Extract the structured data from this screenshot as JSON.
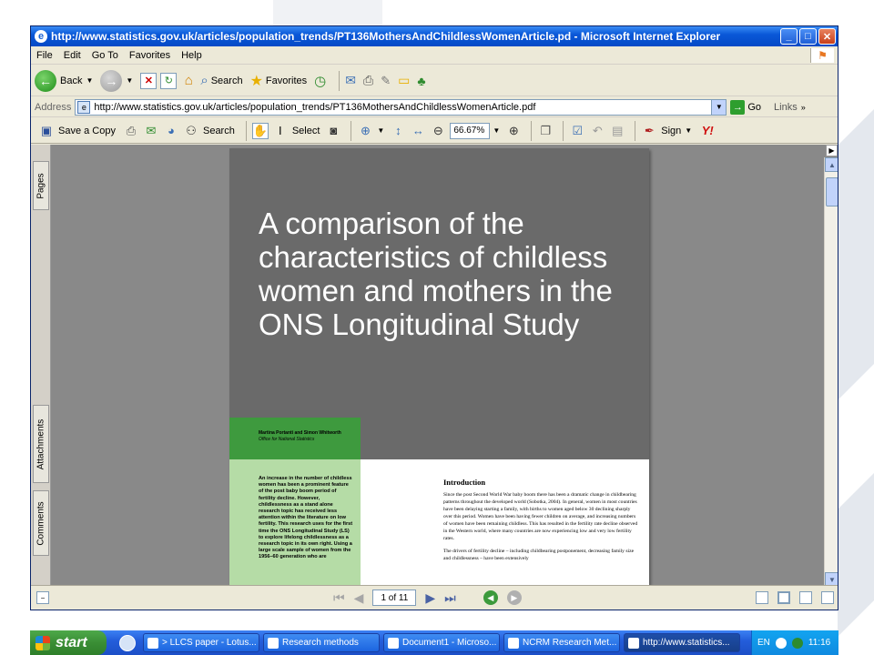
{
  "window": {
    "title": "http://www.statistics.gov.uk/articles/population_trends/PT136MothersAndChildlessWomenArticle.pd - Microsoft Internet Explorer",
    "controls": {
      "minimize": "_",
      "maximize": "□",
      "close": "✕"
    }
  },
  "menu": [
    "File",
    "Edit",
    "Go To",
    "Favorites",
    "Help"
  ],
  "toolbar": {
    "back": "Back",
    "search": "Search",
    "favorites": "Favorites"
  },
  "address": {
    "label": "Address",
    "url": "http://www.statistics.gov.uk/articles/population_trends/PT136MothersAndChildlessWomenArticle.pdf",
    "go": "Go",
    "links": "Links"
  },
  "pdf_toolbar": {
    "save_copy": "Save a Copy",
    "search": "Search",
    "select": "Select",
    "zoom": "66.67%",
    "sign": "Sign"
  },
  "side_tabs": [
    "Pages",
    "Attachments",
    "Comments"
  ],
  "document": {
    "title": "A comparison of the characteristics of childless women and mothers in the ONS Longitudinal Study",
    "authors": "Martina Portanti and Simon Whitworth",
    "affiliation": "Office for National Statistics",
    "abstract": "An increase in the number of childless women has been a prominent feature of the post baby boom period of fertility decline. However, childlessness as a stand alone research topic has received less attention within the literature on low fertility. This research uses for the first time the ONS Longitudinal Study (LS) to explore lifelong childlessness as a research topic in its own right. Using a large scale sample of women from the 1956–60 generation who are",
    "intro_heading": "Introduction",
    "intro_p1": "Since the post Second World War baby boom there has been a dramatic change in childbearing patterns throughout the developed world (Sobotka, 2004). In general, women in most countries have been delaying starting a family, with births to women aged below 30 declining sharply over this period. Women have been having fewer children on average, and increasing numbers of women have been remaining childless. This has resulted in the fertility rate decline observed in the Western world, where many countries are now experiencing low and very low fertility rates.",
    "intro_p2": "The drivers of fertility decline – including childbearing postponement, decreasing family size and childlessness – have been extensively"
  },
  "status": {
    "page": "1 of 11"
  },
  "taskbar": {
    "start": "start",
    "tasks": [
      "> LLCS paper - Lotus...",
      "Research methods",
      "Document1 - Microso...",
      "NCRM Research Met...",
      "http://www.statistics..."
    ],
    "lang": "EN",
    "clock": "11:16"
  }
}
